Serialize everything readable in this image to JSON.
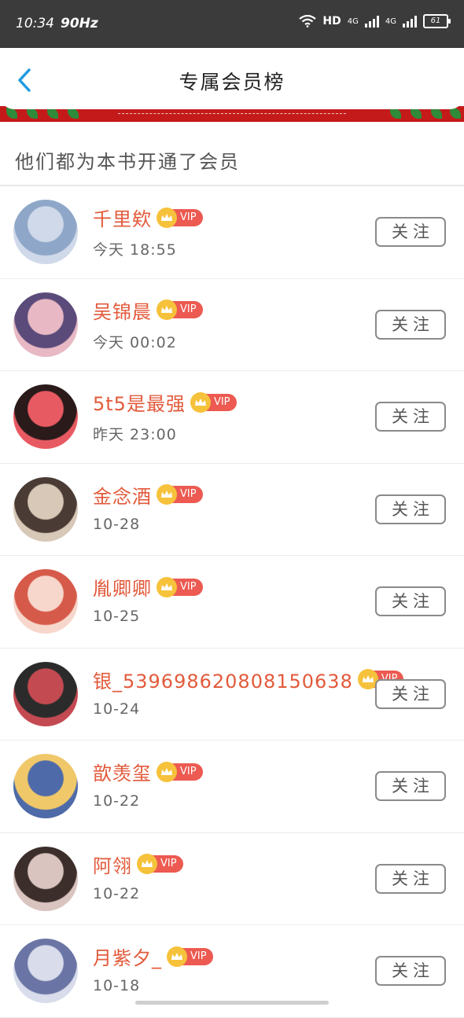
{
  "statusbar": {
    "time": "10:34",
    "refresh": "90Hz",
    "network": "HD",
    "sig1": "4G",
    "sig2": "4G",
    "battery": "61"
  },
  "header": {
    "title": "专属会员榜"
  },
  "intro": "他们都为本书开通了会员",
  "badge_label": "VIP",
  "follow_label": "关注",
  "members": [
    {
      "name": "千里欸",
      "time": "今天 18:55",
      "avatar": [
        "#cfd9ea",
        "#8ea7c8"
      ]
    },
    {
      "name": "吴锦晨",
      "time": "今天 00:02",
      "avatar": [
        "#e8b9c4",
        "#5b4b7a"
      ]
    },
    {
      "name": "5t5是最强",
      "time": "昨天 23:00",
      "avatar": [
        "#e85a62",
        "#2a1a1a"
      ]
    },
    {
      "name": "金念酒",
      "time": "10-28",
      "avatar": [
        "#d8c8b8",
        "#4a3b35"
      ]
    },
    {
      "name": "胤卿卿",
      "time": "10-25",
      "avatar": [
        "#f7d7cc",
        "#d65a4a"
      ]
    },
    {
      "name": "银_53969862080815063​8",
      "time": "10-24",
      "avatar": [
        "#c44a52",
        "#2b2b2b"
      ]
    },
    {
      "name": "歆羡玺",
      "time": "10-22",
      "avatar": [
        "#4e6aa8",
        "#f0c86a"
      ]
    },
    {
      "name": "阿翎",
      "time": "10-22",
      "avatar": [
        "#d9c4c0",
        "#3c2e2b"
      ]
    },
    {
      "name": "月紫夕_",
      "time": "10-18",
      "avatar": [
        "#d8dceb",
        "#6a75a5"
      ]
    }
  ]
}
